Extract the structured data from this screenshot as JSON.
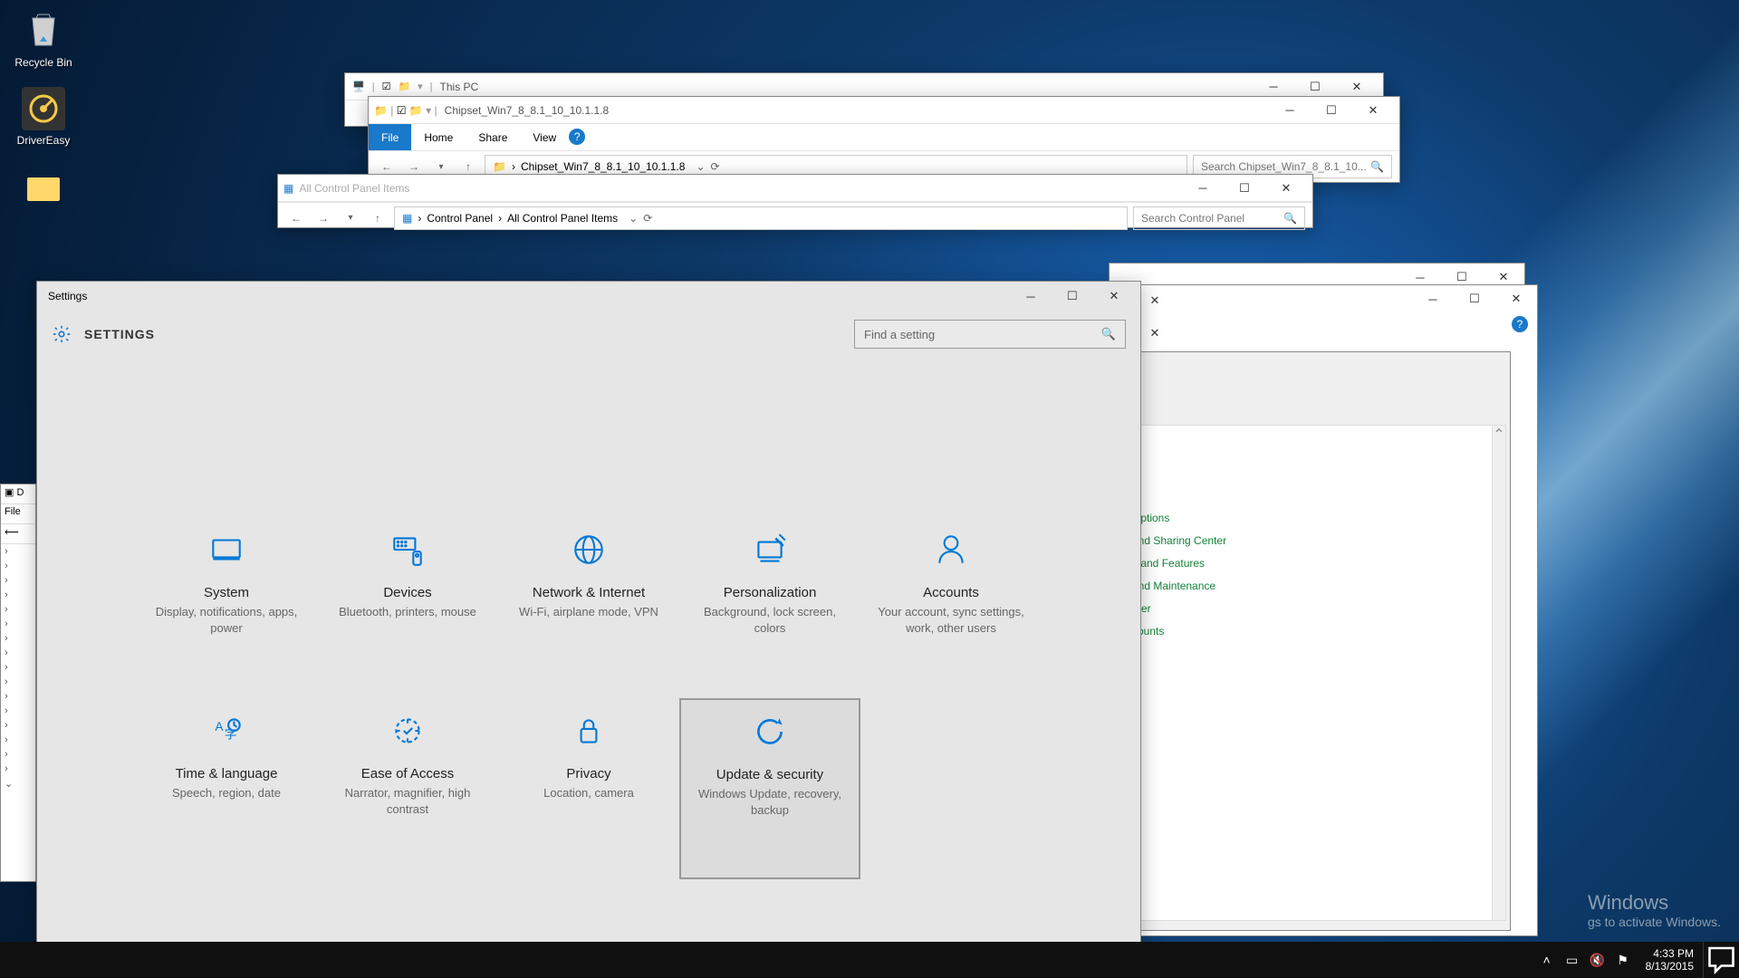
{
  "desktop": {
    "icons": [
      {
        "label": "Recycle Bin"
      },
      {
        "label": "DriverEasy"
      },
      {
        "label": ""
      }
    ]
  },
  "explorer1": {
    "title": "This PC"
  },
  "explorer2": {
    "title": "Chipset_Win7_8_8.1_10_10.1.1.8",
    "tabs": {
      "file": "File",
      "home": "Home",
      "share": "Share",
      "view": "View"
    },
    "path": "Chipset_Win7_8_8.1_10_10.1.1.8",
    "search_placeholder": "Search Chipset_Win7_8_8.1_10..."
  },
  "cpanel": {
    "title": "All Control Panel Items",
    "crumb1": "Control Panel",
    "crumb2": "All Control Panel Items",
    "search_placeholder": "Search Control Panel"
  },
  "green_links": [
    "Options",
    "and Sharing Center",
    "s and Features",
    "and Maintenance",
    "nter",
    "counts"
  ],
  "left_partial": {
    "title": "D",
    "menu": "File"
  },
  "settings": {
    "window_title": "Settings",
    "header": "SETTINGS",
    "search_placeholder": "Find a setting",
    "tiles": [
      {
        "title": "System",
        "sub": "Display, notifications, apps, power"
      },
      {
        "title": "Devices",
        "sub": "Bluetooth, printers, mouse"
      },
      {
        "title": "Network & Internet",
        "sub": "Wi-Fi, airplane mode, VPN"
      },
      {
        "title": "Personalization",
        "sub": "Background, lock screen, colors"
      },
      {
        "title": "Accounts",
        "sub": "Your account, sync settings, work, other users"
      },
      {
        "title": "Time & language",
        "sub": "Speech, region, date"
      },
      {
        "title": "Ease of Access",
        "sub": "Narrator, magnifier, high contrast"
      },
      {
        "title": "Privacy",
        "sub": "Location, camera"
      },
      {
        "title": "Update & security",
        "sub": "Windows Update, recovery, backup"
      }
    ]
  },
  "watermark": {
    "l1": "Windows",
    "l2": "gs to activate Windows."
  },
  "taskbar": {
    "time": "4:33 PM",
    "date": "8/13/2015"
  },
  "behind_help": "?"
}
